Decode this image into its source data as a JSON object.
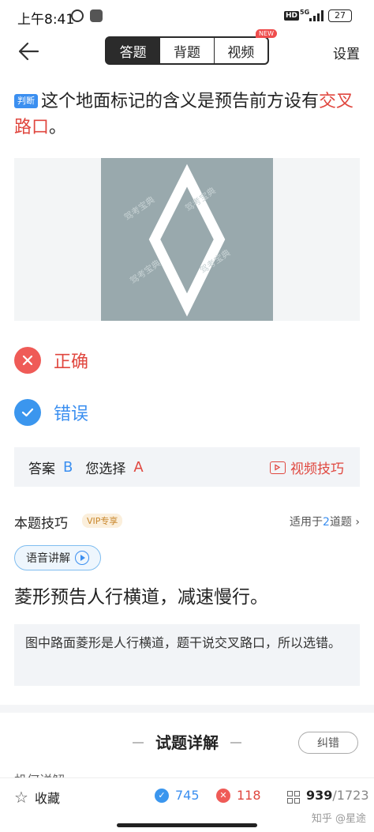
{
  "status_bar": {
    "time": "上午8:41",
    "network_hd": "HD",
    "network_5g": "5G",
    "battery": "27"
  },
  "nav": {
    "tabs": [
      {
        "label": "答题",
        "active": true
      },
      {
        "label": "背题",
        "active": false
      },
      {
        "label": "视频",
        "active": false,
        "badge": "NEW"
      }
    ],
    "settings_label": "设置"
  },
  "question": {
    "tag": "判断",
    "text_before": "这个地面标记的含义是预告前方设有",
    "text_highlight": "交叉路口",
    "text_after": "。"
  },
  "figure": {
    "watermark": "驾考宝典",
    "icon": "diamond-road-marking"
  },
  "options": [
    {
      "label": "正确",
      "state": "wrong",
      "icon": "close-icon",
      "color": "#ef5b57"
    },
    {
      "label": "错误",
      "state": "correct",
      "icon": "check-icon",
      "color": "#3b96ee"
    }
  ],
  "answer": {
    "answer_label": "答案",
    "answer_value": "B",
    "chosen_label": "您选择",
    "chosen_value": "A",
    "video_tip_label": "视频技巧"
  },
  "tips": {
    "title": "本题技巧",
    "vip_label": "VIP专享",
    "applies_prefix": "适用于",
    "applies_count": "2",
    "applies_suffix": "道题",
    "audio_label": "语音讲解",
    "main_tip": "菱形预告人行横道，减速慢行。",
    "explanation": "图中路面菱形是人行横道，题干说交叉路口，所以选错。"
  },
  "detail": {
    "title": "试题详解",
    "correct_button": "纠错",
    "peek_text": "机何详解"
  },
  "bottom_bar": {
    "favorite_label": "收藏",
    "correct_count": "745",
    "wrong_count": "118",
    "current": "939",
    "total": "/1723",
    "watermark": "知乎 @星途"
  },
  "colors": {
    "accent_blue": "#3b8ff0",
    "accent_red": "#e0473f",
    "figure_bg": "#99a9ad"
  }
}
